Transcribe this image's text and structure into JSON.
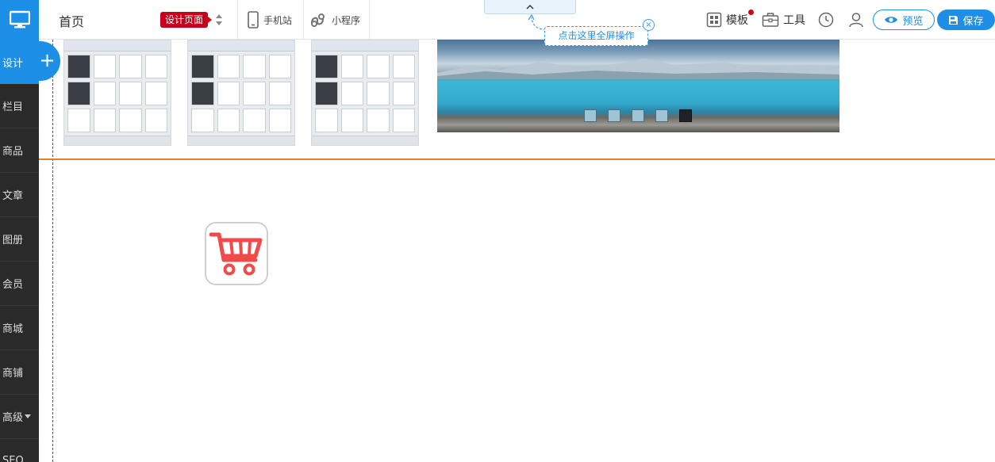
{
  "sidebar": {
    "items": [
      {
        "label": "设计"
      },
      {
        "label": "栏目"
      },
      {
        "label": "商品"
      },
      {
        "label": "文章"
      },
      {
        "label": "图册"
      },
      {
        "label": "会员"
      },
      {
        "label": "商城"
      },
      {
        "label": "商铺"
      },
      {
        "label": "高级"
      },
      {
        "label": "SEO"
      }
    ]
  },
  "topbar": {
    "page_name": "首页",
    "design_tag": "设计页面",
    "mobile_label": "手机站",
    "miniprogram_label": "小程序",
    "template_label": "模板",
    "tools_label": "工具",
    "preview_label": "预览",
    "save_label": "保存",
    "fullscreen_tip": "点击这里全屏操作"
  },
  "canvas": {
    "slider": {
      "dot_count": 5,
      "active_index": 4
    }
  },
  "colors": {
    "accent": "#1e8fe6",
    "sidebar_bg": "#2a2a2a",
    "design_tag": "#c8001e",
    "divider_line": "#f07b20",
    "cart_red": "#f04b4b"
  }
}
